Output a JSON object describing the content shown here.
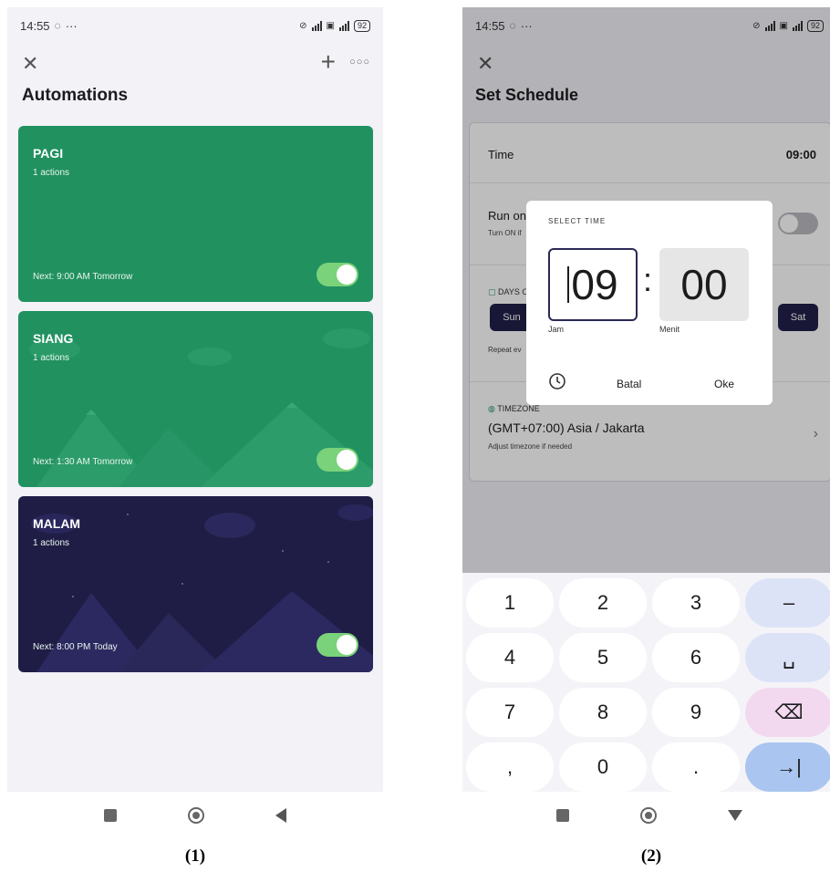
{
  "screen1": {
    "status": {
      "time": "14:55",
      "battery": "92"
    },
    "title": "Automations",
    "icons": {
      "close": "close-icon",
      "add": "plus-icon",
      "more": "more-icon"
    },
    "cards": [
      {
        "name": "PAGI",
        "actions": "1 actions",
        "next": "Next: 9:00 AM Tomorrow",
        "enabled": true,
        "color": "#219160"
      },
      {
        "name": "SIANG",
        "actions": "1 actions",
        "next": "Next: 1:30 AM Tomorrow",
        "enabled": true,
        "color": "#219160"
      },
      {
        "name": "MALAM",
        "actions": "1 actions",
        "next": "Next: 8:00 PM Today",
        "enabled": true,
        "color": "#1f1d45"
      }
    ],
    "caption": "(1)"
  },
  "screen2": {
    "status": {
      "time": "14:55",
      "battery": "92"
    },
    "title": "Set Schedule",
    "time_label": "Time",
    "time_value": "09:00",
    "run_once_label": "Run on",
    "run_once_sub": "Turn ON if",
    "days_label": "DAYS O",
    "day_sun": "Sun",
    "day_sat": "Sat",
    "repeat_label": "Repeat ev",
    "timezone_label": "TIMEZONE",
    "timezone_value": "(GMT+07:00) Asia / Jakarta",
    "timezone_sub": "Adjust timezone if needed",
    "dialog": {
      "title": "SELECT TIME",
      "hour": "09",
      "minute": "00",
      "hour_label": "Jam",
      "minute_label": "Menit",
      "cancel": "Batal",
      "ok": "Oke"
    },
    "keys": [
      "1",
      "2",
      "3",
      "–",
      "4",
      "5",
      "6",
      "␣",
      "7",
      "8",
      "9",
      "⌫",
      ",",
      "0",
      ".",
      "→|"
    ],
    "caption": "(2)"
  }
}
